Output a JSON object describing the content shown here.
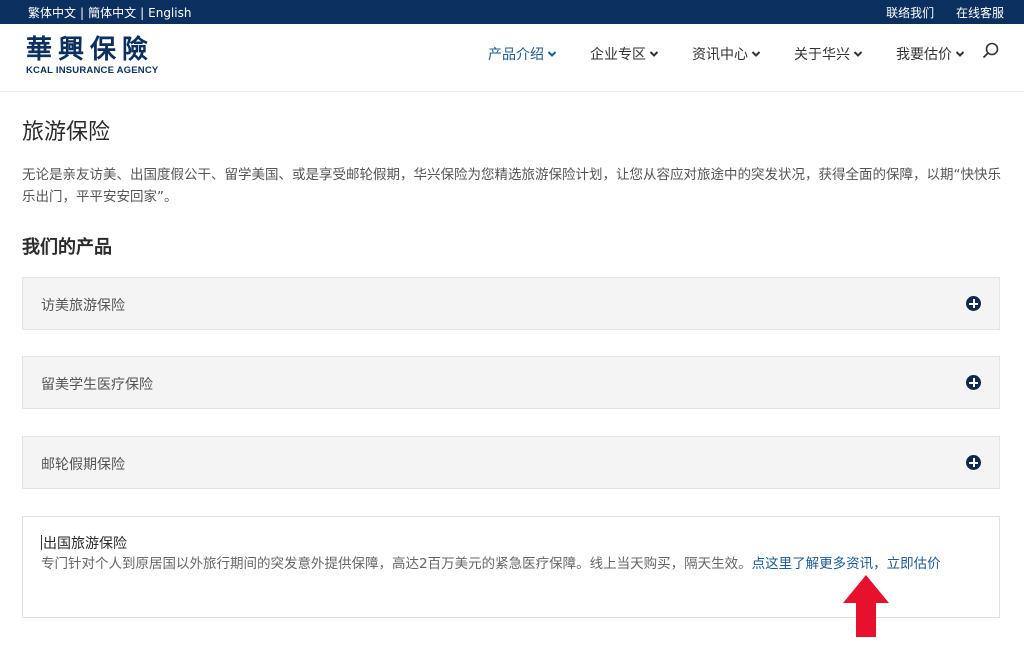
{
  "topbar": {
    "lang_traditional": "繁体中文",
    "lang_simplified": "簡体中文",
    "lang_english": "English",
    "contact": "联络我们",
    "online_service": "在线客服"
  },
  "logo": {
    "name_cn": "華興保險",
    "name_en": "KCAL INSURANCE AGENCY"
  },
  "nav": {
    "items": [
      {
        "label": "产品介绍"
      },
      {
        "label": "企业专区"
      },
      {
        "label": "资讯中心"
      },
      {
        "label": "关于华兴"
      },
      {
        "label": "我要估价"
      }
    ],
    "search_icon": "search-icon"
  },
  "page": {
    "title": "旅游保险",
    "intro": "无论是亲友访美、出国度假公干、留学美国、或是享受邮轮假期，华兴保险为您精选旅游保险计划，让您从容应对旅途中的突发状况，获得全面的保障，以期“快快乐乐出门，平平安安回家”。",
    "products_title": "我们的产品"
  },
  "accordion": [
    {
      "label": "访美旅游保险"
    },
    {
      "label": "留美学生医疗保险"
    },
    {
      "label": "邮轮假期保险"
    }
  ],
  "panel": {
    "title": "出国旅游保险",
    "description": "专门针对个人到原居国以外旅行期间的突发意外提供保障，高达2百万美元的紧急医疗保障。线上当天购买，隔天生效。",
    "link_more": "点这里了解更多资讯",
    "separator": "，",
    "link_quote": "立即估价"
  },
  "colors": {
    "topbar_bg": "#0b2f5e",
    "brand": "#0b2f5e",
    "link": "#1d5a96",
    "accent_arrow": "#e8112d"
  }
}
